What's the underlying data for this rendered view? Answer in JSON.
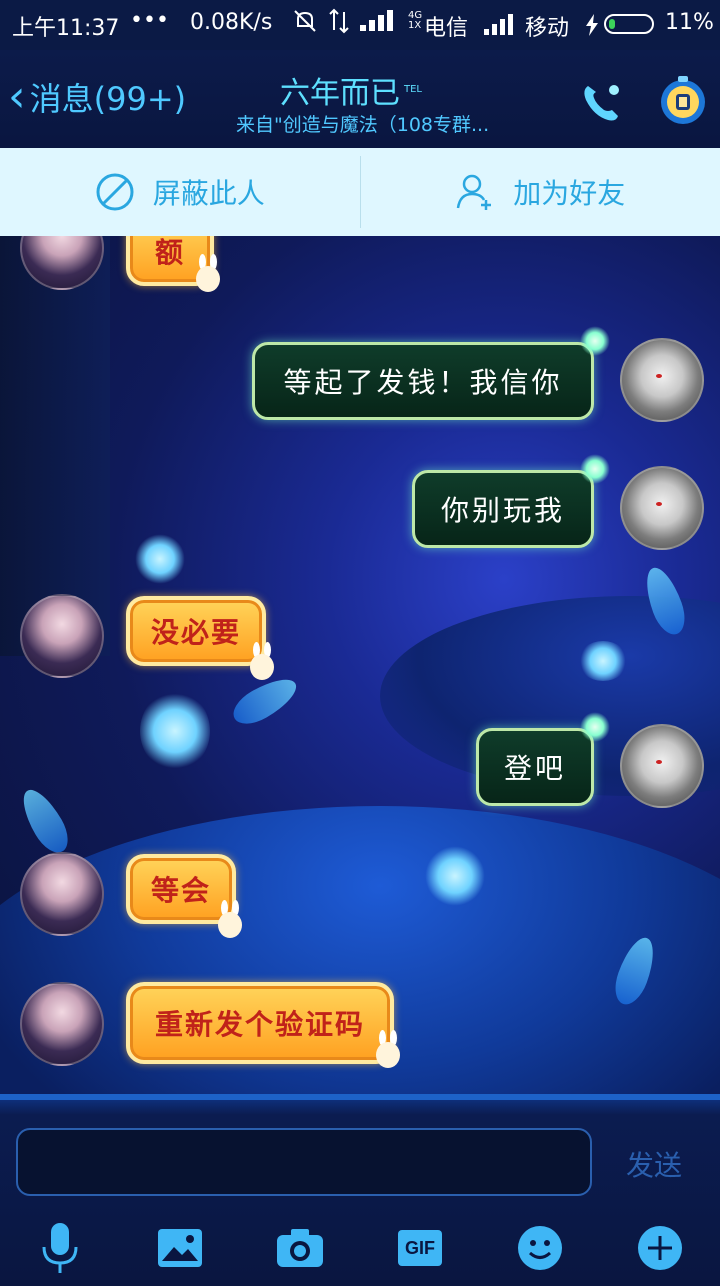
{
  "status_bar": {
    "time": "上午11:37",
    "dots": "•••",
    "speed": "0.08K/s",
    "net_badge": "4G 1X",
    "carrier1": "电信",
    "carrier2": "移动",
    "battery": "11%"
  },
  "header": {
    "back_label": "消息(99+)",
    "title": "六年而已",
    "title_badge": "TEL",
    "subtitle": "来自\"创造与魔法（108专群..."
  },
  "actions": {
    "block": "屏蔽此人",
    "add_friend": "加为好友"
  },
  "messages": [
    {
      "side": "left",
      "text": "额"
    },
    {
      "side": "right",
      "text": "等起了发钱！我信你"
    },
    {
      "side": "right",
      "text": "你别玩我"
    },
    {
      "side": "left",
      "text": "没必要"
    },
    {
      "side": "right",
      "text": "登吧"
    },
    {
      "side": "left",
      "text": "等会"
    },
    {
      "side": "left",
      "text": "重新发个验证码"
    }
  ],
  "input": {
    "value": "",
    "send_label": "发送"
  },
  "toolbar": {
    "gif_label": "GIF"
  },
  "colors": {
    "accent": "#4fc9ff",
    "orange_bubble": "#ffb02e",
    "green_bubble": "#0f3c2a"
  }
}
